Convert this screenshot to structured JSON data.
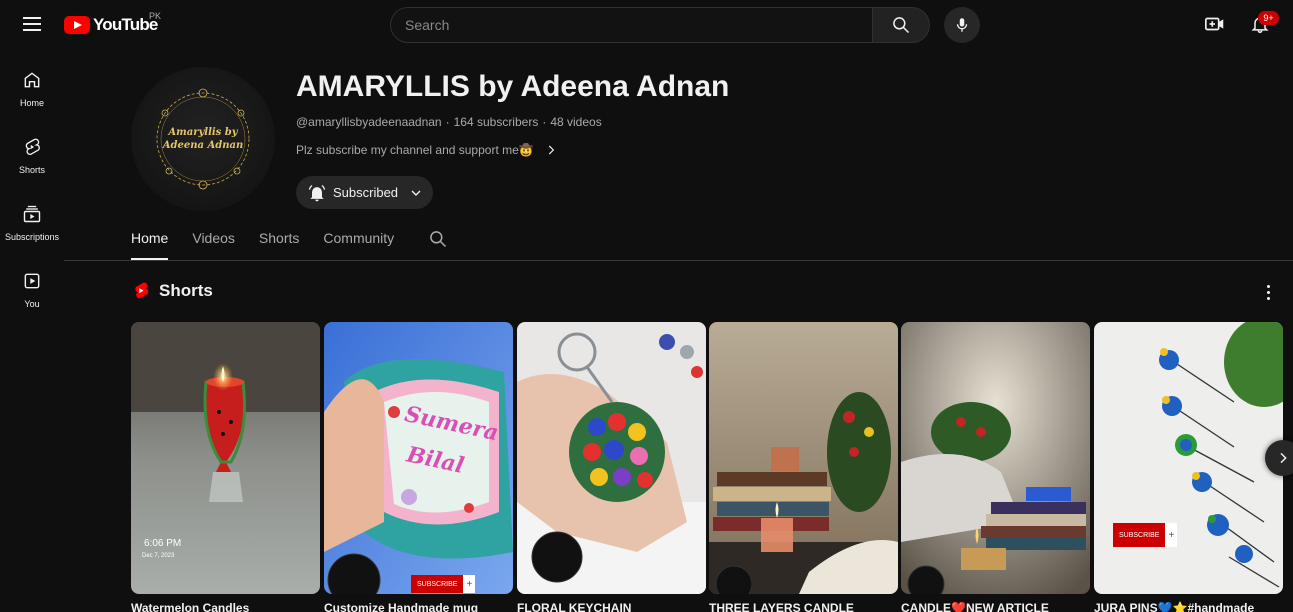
{
  "topbar": {
    "logo_text": "YouTube",
    "country_code": "PK",
    "search_placeholder": "Search",
    "notification_count": "9+"
  },
  "guide": [
    {
      "label": "Home",
      "icon": "home-icon"
    },
    {
      "label": "Shorts",
      "icon": "shorts-icon"
    },
    {
      "label": "Subscriptions",
      "icon": "subscriptions-icon"
    },
    {
      "label": "You",
      "icon": "you-icon"
    }
  ],
  "channel": {
    "name": "AMARYLLIS by Adeena Adnan",
    "handle": "@amaryllisbyadeenaadnan",
    "subscribers": "164 subscribers",
    "videos": "48 videos",
    "description": "Plz subscribe my channel and support me🤠",
    "avatar_text_line1": "Amaryllis by",
    "avatar_text_line2": "Adeena Adnan",
    "subscribe_label": "Subscribed"
  },
  "tabs": [
    "Home",
    "Videos",
    "Shorts",
    "Community"
  ],
  "active_tab": "Home",
  "shelf": {
    "title": "Shorts",
    "items": [
      {
        "title": "Watermelon Candles",
        "overlay_time": "6:06 PM",
        "overlay_date": "Dec 7, 2023"
      },
      {
        "title": "Customize Handmade mug",
        "overlay_text1": "Sumera",
        "overlay_text2": "Bilal",
        "subscribe_chip": "SUBSCRIBE"
      },
      {
        "title": "FLORAL KEYCHAIN"
      },
      {
        "title": "THREE LAYERS CANDLE"
      },
      {
        "title": "CANDLE❤️NEW ARTICLE"
      },
      {
        "title": "JURA PINS💙⭐#handmade",
        "subscribe_chip": "SUBSCRIBE"
      }
    ]
  },
  "colors": {
    "background": "#0f0f0f",
    "brand_red": "#ff0000",
    "text": "#f1f1f1",
    "muted": "#aaaaaa"
  }
}
